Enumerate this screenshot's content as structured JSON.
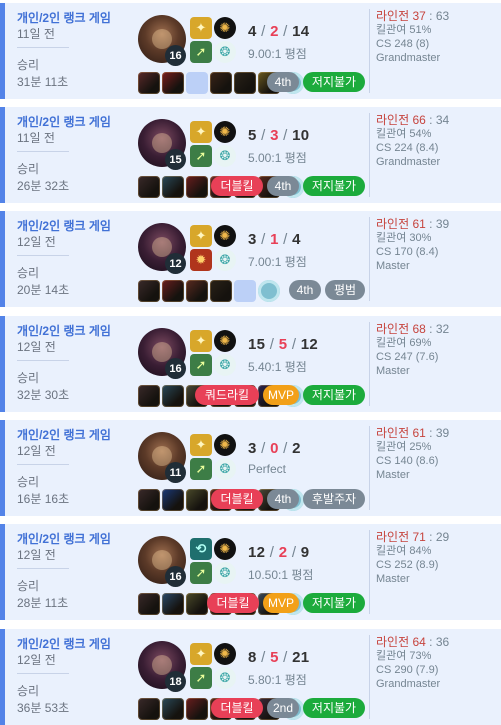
{
  "games": [
    {
      "queue": "개인/2인 랭크 게임",
      "ago": "11일 전",
      "result": "승리",
      "duration": "31분 11초",
      "champion": "darius-icon",
      "level": "16",
      "spells": [
        "flash",
        "ghost"
      ],
      "runes": [
        "conqueror",
        "resolve"
      ],
      "kills": "4",
      "deaths": "2",
      "assists": "14",
      "ratio": "9.00:1 평점",
      "items": [
        "#5b2a2a",
        "#7a1e1e",
        "empty",
        "#3a2418",
        "#2a2218",
        "#6a5a20",
        "ward"
      ],
      "badges": [
        {
          "text": "4th",
          "color": "gray"
        },
        {
          "text": "저지불가",
          "color": "green"
        }
      ],
      "lane_label": "라인전",
      "lane_win": "37",
      "lane_lose": "63",
      "kill_part": "킬관여 51%",
      "cs": "CS 248 (8)",
      "tier": "Grandmaster"
    },
    {
      "queue": "개인/2인 랭크 게임",
      "ago": "11일 전",
      "result": "승리",
      "duration": "26분 32초",
      "champion": "mordekaiser-icon",
      "level": "15",
      "spells": [
        "flash",
        "ghost"
      ],
      "runes": [
        "conqueror",
        "resolve"
      ],
      "kills": "5",
      "deaths": "3",
      "assists": "10",
      "ratio": "5.00:1 평점",
      "items": [
        "#3a2a2a",
        "#2a4a5a",
        "#6a1e1e",
        "#6a2a2a",
        "#3a2450",
        "#5a2a20",
        "ward"
      ],
      "badges": [
        {
          "text": "더블킬",
          "color": "red"
        },
        {
          "text": "4th",
          "color": "gray"
        },
        {
          "text": "저지불가",
          "color": "green"
        }
      ],
      "lane_label": "라인전",
      "lane_win": "66",
      "lane_lose": "34",
      "kill_part": "킬관여 54%",
      "cs": "CS 224 (8.4)",
      "tier": "Grandmaster"
    },
    {
      "queue": "개인/2인 랭크 게임",
      "ago": "12일 전",
      "result": "승리",
      "duration": "20분 14초",
      "champion": "mordekaiser-icon",
      "level": "12",
      "spells": [
        "flash",
        "ignite"
      ],
      "runes": [
        "conqueror",
        "resolve"
      ],
      "kills": "3",
      "deaths": "1",
      "assists": "4",
      "ratio": "7.00:1 평점",
      "items": [
        "#3a2a2a",
        "#6a1e1e",
        "#5a2a20",
        "#2a2218",
        "empty",
        "ward"
      ],
      "badges": [
        {
          "text": "4th",
          "color": "gray"
        },
        {
          "text": "평범",
          "color": "gray"
        }
      ],
      "lane_label": "라인전",
      "lane_win": "61",
      "lane_lose": "39",
      "kill_part": "킬관여 30%",
      "cs": "CS 170 (8.4)",
      "tier": "Master"
    },
    {
      "queue": "개인/2인 랭크 게임",
      "ago": "12일 전",
      "result": "승리",
      "duration": "32분 30초",
      "champion": "mordekaiser-icon",
      "level": "16",
      "spells": [
        "flash",
        "ghost"
      ],
      "runes": [
        "conqueror",
        "resolve"
      ],
      "kills": "15",
      "deaths": "5",
      "assists": "12",
      "ratio": "5.40:1 평점",
      "items": [
        "#3a2a2a",
        "#2a4a5a",
        "#4a4a3a",
        "#5a2a20",
        "#6a1e1e",
        "#2a2450",
        "ward"
      ],
      "badges": [
        {
          "text": "쿼드라킬",
          "color": "red"
        },
        {
          "text": "MVP",
          "color": "orange"
        },
        {
          "text": "저지불가",
          "color": "green"
        }
      ],
      "lane_label": "라인전",
      "lane_win": "68",
      "lane_lose": "32",
      "kill_part": "킬관여 69%",
      "cs": "CS 247 (7.6)",
      "tier": "Master"
    },
    {
      "queue": "개인/2인 랭크 게임",
      "ago": "12일 전",
      "result": "승리",
      "duration": "16분 16초",
      "champion": "darius-icon",
      "level": "11",
      "spells": [
        "flash",
        "ghost"
      ],
      "runes": [
        "conqueror",
        "resolve"
      ],
      "kills": "3",
      "deaths": "0",
      "assists": "2",
      "ratio": "Perfect",
      "items": [
        "#3a2a2a",
        "#1a3a7a",
        "#4a4a2a",
        "#5a2a20",
        "#6a4a2a",
        "#4a4a3a",
        "ward"
      ],
      "badges": [
        {
          "text": "더블킬",
          "color": "red"
        },
        {
          "text": "4th",
          "color": "gray"
        },
        {
          "text": "후발주자",
          "color": "gray"
        }
      ],
      "lane_label": "라인전",
      "lane_win": "61",
      "lane_lose": "39",
      "kill_part": "킬관여 25%",
      "cs": "CS 140 (8.6)",
      "tier": "Master"
    },
    {
      "queue": "개인/2인 랭크 게임",
      "ago": "12일 전",
      "result": "승리",
      "duration": "28분 11초",
      "champion": "darius-icon",
      "level": "16",
      "spells": [
        "teleport",
        "ghost"
      ],
      "runes": [
        "conqueror",
        "resolve"
      ],
      "kills": "12",
      "deaths": "2",
      "assists": "9",
      "ratio": "10.50:1 평점",
      "items": [
        "#3a2a2a",
        "#2a4a6a",
        "#4a4a2a",
        "#5a2a20",
        "#6a5a20",
        "#3a4a5a",
        "ward"
      ],
      "badges": [
        {
          "text": "더블킬",
          "color": "red"
        },
        {
          "text": "MVP",
          "color": "orange"
        },
        {
          "text": "저지불가",
          "color": "green"
        }
      ],
      "lane_label": "라인전",
      "lane_win": "71",
      "lane_lose": "29",
      "kill_part": "킬관여 84%",
      "cs": "CS 252 (8.9)",
      "tier": "Master"
    },
    {
      "queue": "개인/2인 랭크 게임",
      "ago": "12일 전",
      "result": "승리",
      "duration": "36분 53초",
      "champion": "mordekaiser-icon",
      "level": "18",
      "spells": [
        "flash",
        "ghost"
      ],
      "runes": [
        "conqueror",
        "resolve"
      ],
      "kills": "8",
      "deaths": "5",
      "assists": "21",
      "ratio": "5.80:1 평점",
      "items": [
        "#3a2a2a",
        "#2a4a5a",
        "#6a1e1e",
        "#5a2a20",
        "#3a2450",
        "#3a2a3a",
        "ward"
      ],
      "badges": [
        {
          "text": "더블킬",
          "color": "red"
        },
        {
          "text": "2nd",
          "color": "gray"
        },
        {
          "text": "저지불가",
          "color": "green"
        }
      ],
      "lane_label": "라인전",
      "lane_win": "64",
      "lane_lose": "36",
      "kill_part": "킬관여 73%",
      "cs": "CS 290 (7.9)",
      "tier": "Grandmaster"
    }
  ]
}
